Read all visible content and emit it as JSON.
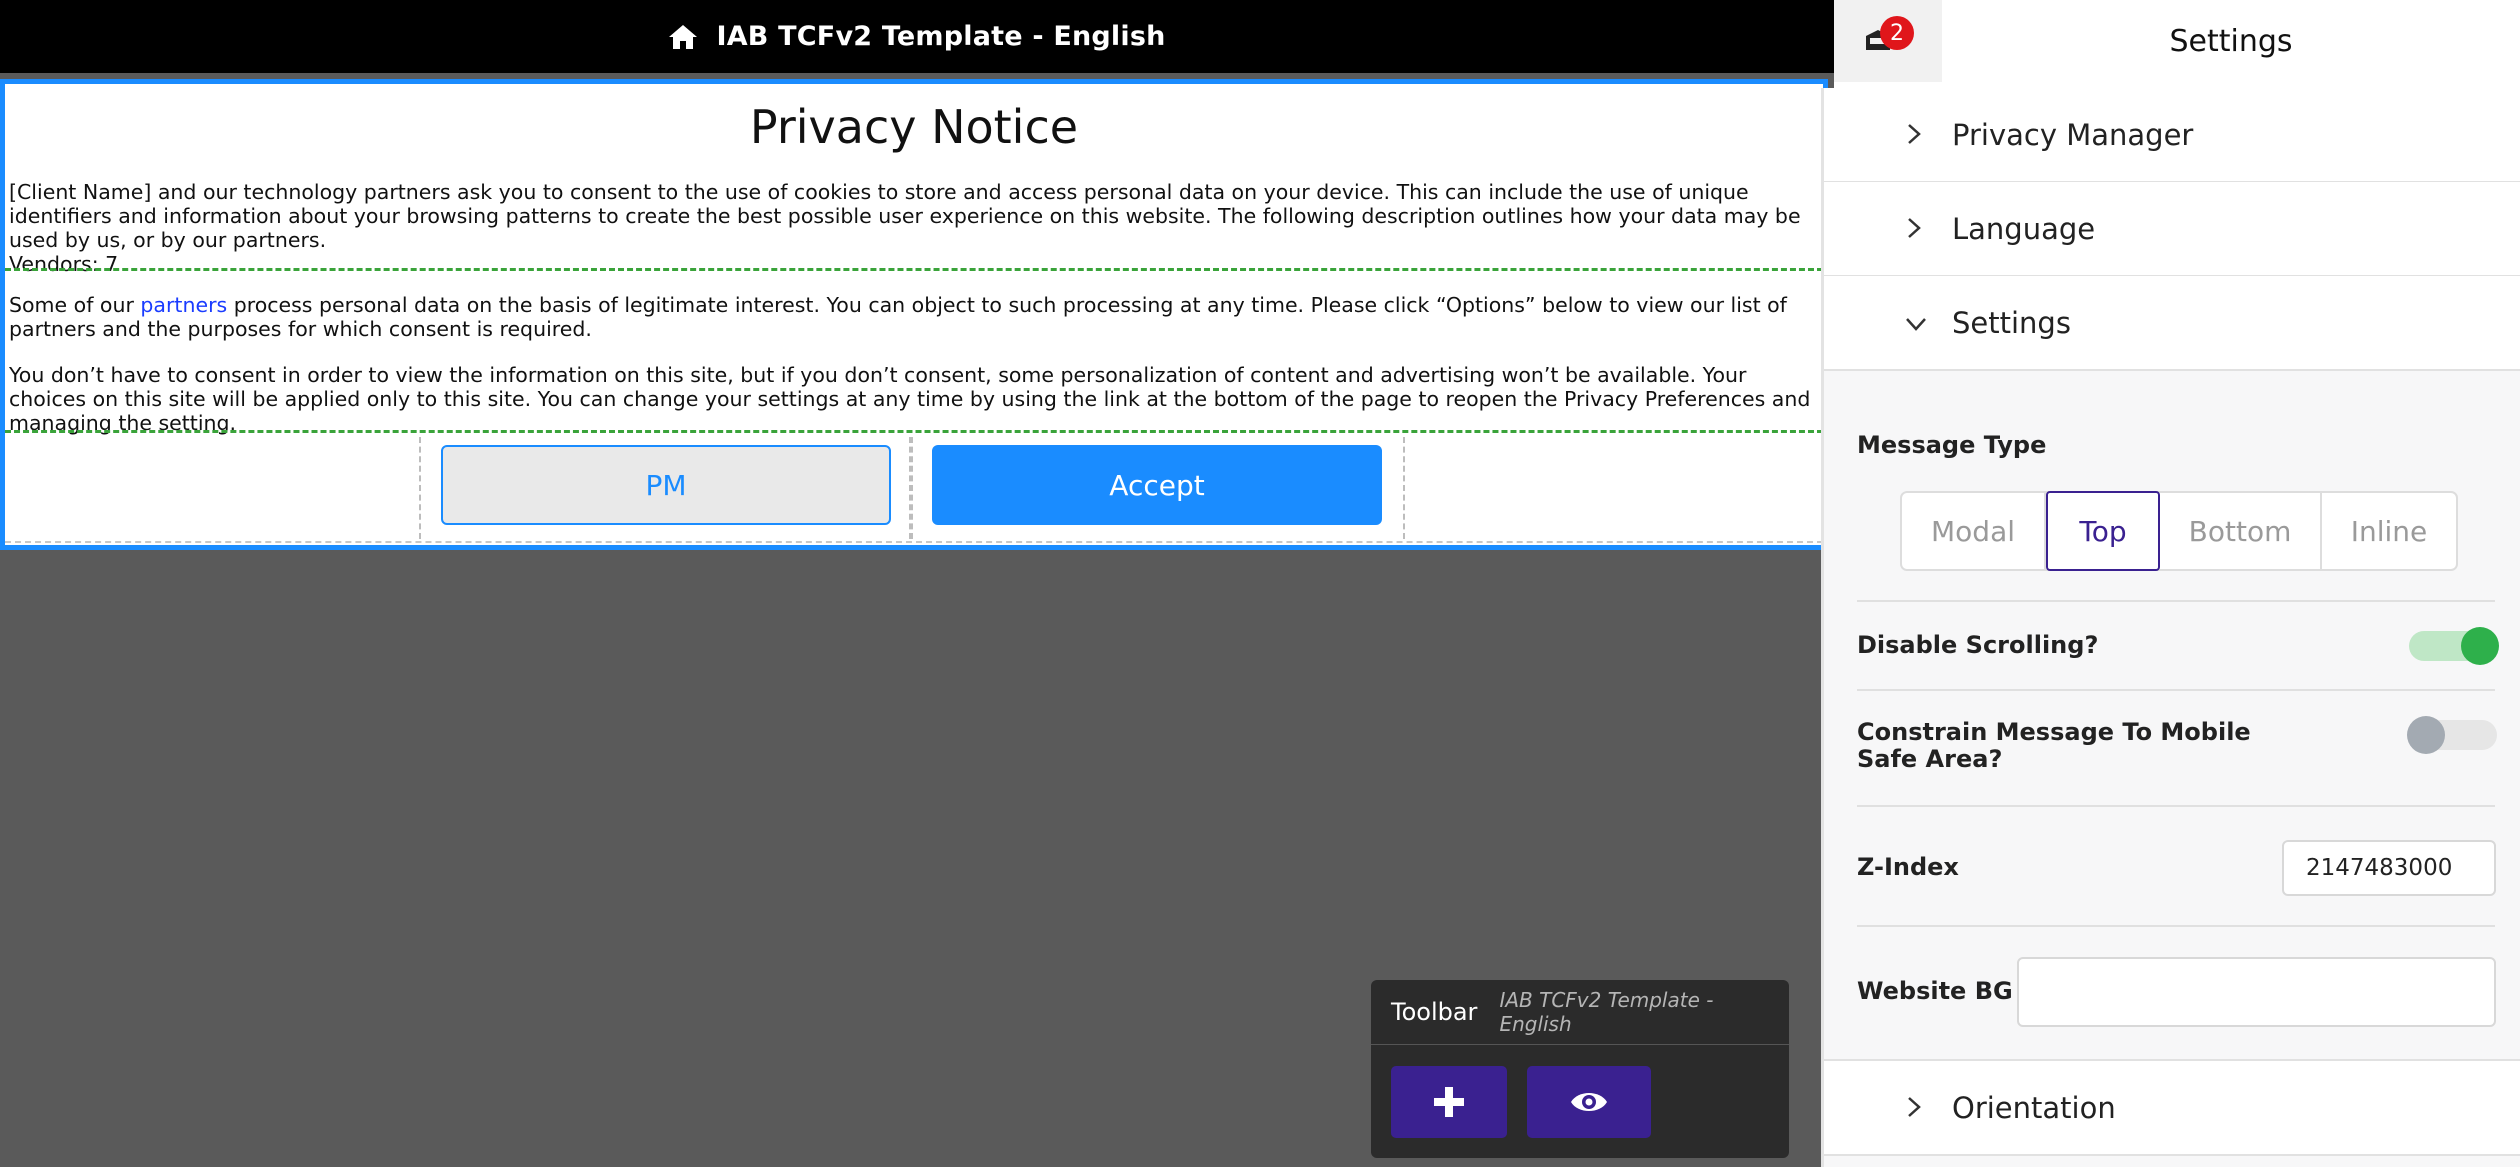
{
  "header": {
    "title": "IAB TCFv2 Template - English"
  },
  "message": {
    "title": "Privacy Notice",
    "paragraph1": "[Client Name] and our technology partners ask you to consent to the use of cookies to store and access personal data on your device. This can include the use of unique identifiers and information about your browsing patterns to create the best possible user experience on this website. The following description outlines how your data may be used by us, or by our partners.",
    "vendors": "Vendors: 7",
    "paragraph2_before": "Some of our ",
    "paragraph2_link": "partners",
    "paragraph2_after": " process personal data on the basis of legitimate interest. You can object to such processing at any time. Please click “Options” below to view our list of partners and the purposes for which consent is required.",
    "paragraph3": "You don’t have to consent in order to view the information on this site, but if you don’t consent, some personalization of content and advertising won’t be available. Your choices on this site will be applied only to this site. You can change your settings at any time by using the link at the bottom of the page to reopen the Privacy Preferences and managing the setting.",
    "pm_label": "PM",
    "accept_label": "Accept"
  },
  "toolbar": {
    "title": "Toolbar",
    "subtitle": "IAB TCFv2 Template - English",
    "add_icon": "plus-icon",
    "preview_icon": "eye-icon"
  },
  "panel": {
    "title": "Settings",
    "notification_count": "2",
    "sections": [
      {
        "label": "Privacy Manager",
        "expanded": false
      },
      {
        "label": "Language",
        "expanded": false
      },
      {
        "label": "Settings",
        "expanded": true
      },
      {
        "label": "Orientation",
        "expanded": false
      }
    ],
    "message_type": {
      "label": "Message Type",
      "options": [
        "Modal",
        "Top",
        "Bottom",
        "Inline"
      ],
      "selected": "Top"
    },
    "disable_scrolling": {
      "label": "Disable Scrolling?",
      "on": true
    },
    "constrain_mobile": {
      "label": "Constrain Message To Mobile Safe Area?",
      "on": false
    },
    "z_index": {
      "label": "Z-Index",
      "value": "2147483000"
    },
    "website_bg": {
      "label": "Website BG",
      "value": ""
    }
  },
  "colors": {
    "accent": "#1a8cff",
    "toolbar_button": "#3a2190",
    "toggle_on": "#2eb04b",
    "badge": "#e0161b"
  }
}
